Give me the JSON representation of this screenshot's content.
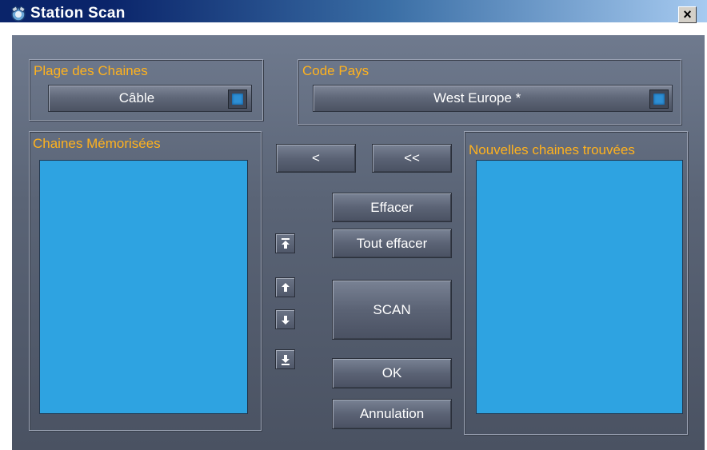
{
  "window": {
    "title": "Station Scan",
    "close_glyph": "×"
  },
  "channel_range": {
    "label": "Plage des Chaines",
    "value": "Câble"
  },
  "country_code": {
    "label": "Code Pays",
    "value": "West Europe *"
  },
  "stored_channels": {
    "label": "Chaines Mémorisées"
  },
  "new_channels": {
    "label": "Nouvelles chaines trouvées"
  },
  "buttons": {
    "move_one": "<",
    "move_all": "<<",
    "delete": "Effacer",
    "delete_all": "Tout effacer",
    "scan": "SCAN",
    "ok": "OK",
    "cancel": "Annulation"
  },
  "icons": {
    "app": "satellite-icon",
    "top": "move-to-top-icon",
    "up": "move-up-icon",
    "down": "move-down-icon",
    "bottom": "move-to-bottom-icon"
  },
  "colors": {
    "label": "#ffb21e",
    "list_bg": "#2ea3e1",
    "panel": "#5a6476"
  }
}
